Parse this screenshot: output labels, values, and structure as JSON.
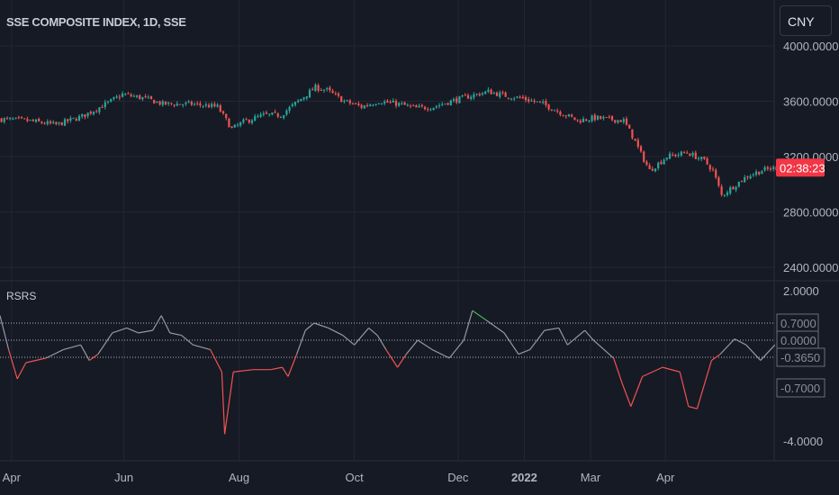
{
  "header": {
    "title": "SSE COMPOSITE INDEX, 1D, SSE",
    "currency": "CNY",
    "countdown": "02:38:23"
  },
  "colors": {
    "up": "#26a69a",
    "down": "#ef5350",
    "neutral": "#9598a1",
    "bg": "#161a25",
    "grid": "#232733",
    "countdown_bg": "#f23645"
  },
  "chart_data": [
    {
      "type": "candlestick",
      "title": "SSE COMPOSITE INDEX, 1D, SSE",
      "y_ticks": [
        "4000.0000",
        "3600.0000",
        "3200.0000",
        "2800.0000",
        "2400.0000"
      ],
      "y_tick_values": [
        4000,
        3600,
        3200,
        2800,
        2400
      ],
      "x_ticks": [
        "Apr",
        "Jun",
        "Aug",
        "Oct",
        "Dec",
        "2022",
        "Mar",
        "Apr"
      ],
      "x_tick_sessions": [
        4,
        43,
        83,
        123,
        159,
        182,
        205,
        231
      ],
      "close_keypoints": [
        [
          0,
          3470
        ],
        [
          9,
          3460
        ],
        [
          19,
          3430
        ],
        [
          28,
          3490
        ],
        [
          38,
          3600
        ],
        [
          42,
          3650
        ],
        [
          50,
          3620
        ],
        [
          56,
          3580
        ],
        [
          66,
          3580
        ],
        [
          75,
          3560
        ],
        [
          80,
          3400
        ],
        [
          84,
          3450
        ],
        [
          91,
          3500
        ],
        [
          97,
          3500
        ],
        [
          103,
          3600
        ],
        [
          109,
          3700
        ],
        [
          113,
          3680
        ],
        [
          119,
          3600
        ],
        [
          125,
          3560
        ],
        [
          131,
          3600
        ],
        [
          138,
          3580
        ],
        [
          144,
          3550
        ],
        [
          150,
          3560
        ],
        [
          156,
          3600
        ],
        [
          163,
          3640
        ],
        [
          169,
          3670
        ],
        [
          175,
          3640
        ],
        [
          181,
          3620
        ],
        [
          188,
          3580
        ],
        [
          194,
          3520
        ],
        [
          200,
          3460
        ],
        [
          206,
          3480
        ],
        [
          216,
          3460
        ],
        [
          219,
          3350
        ],
        [
          222,
          3220
        ],
        [
          225,
          3100
        ],
        [
          231,
          3200
        ],
        [
          238,
          3230
        ],
        [
          244,
          3170
        ],
        [
          247,
          3100
        ],
        [
          250,
          2920
        ],
        [
          255,
          3000
        ],
        [
          259,
          3060
        ],
        [
          264,
          3100
        ],
        [
          269,
          3120
        ]
      ]
    },
    {
      "type": "line",
      "title": "RSRS",
      "y_ticks": [
        "2.0000",
        "-4.0000"
      ],
      "levels": [
        "0.7000",
        "0.0000",
        "-0.3650",
        "-0.7000"
      ],
      "level_values": [
        0.7,
        0,
        -0.365
      ],
      "points": [
        [
          0,
          1.0
        ],
        [
          3,
          -0.2
        ],
        [
          6,
          -1.3
        ],
        [
          9,
          -0.6
        ],
        [
          16,
          -0.4
        ],
        [
          22,
          -0.2
        ],
        [
          28,
          -0.1
        ],
        [
          31,
          -0.5
        ],
        [
          34,
          -0.3
        ],
        [
          39,
          0.3
        ],
        [
          44,
          0.5
        ],
        [
          48,
          0.3
        ],
        [
          53,
          0.4
        ],
        [
          56,
          1.0
        ],
        [
          59,
          0.3
        ],
        [
          63,
          0.2
        ],
        [
          67,
          -0.1
        ],
        [
          73,
          -0.2
        ],
        [
          77,
          -1.0
        ],
        [
          78,
          -3.7
        ],
        [
          81,
          -1.0
        ],
        [
          88,
          -0.9
        ],
        [
          94,
          -0.9
        ],
        [
          98,
          -0.8
        ],
        [
          100,
          -1.2
        ],
        [
          103,
          -0.3
        ],
        [
          106,
          0.4
        ],
        [
          109,
          0.7
        ],
        [
          114,
          0.5
        ],
        [
          119,
          0.2
        ],
        [
          123,
          -0.1
        ],
        [
          128,
          0.5
        ],
        [
          131,
          0.2
        ],
        [
          134,
          -0.2
        ],
        [
          138,
          -0.8
        ],
        [
          141,
          -0.3
        ],
        [
          145,
          0.0
        ],
        [
          150,
          -0.2
        ],
        [
          156,
          -0.4
        ],
        [
          161,
          0.0
        ],
        [
          164,
          1.2
        ],
        [
          169,
          0.8
        ],
        [
          175,
          0.3
        ],
        [
          180,
          -0.3
        ],
        [
          184,
          -0.2
        ],
        [
          189,
          0.4
        ],
        [
          194,
          0.5
        ],
        [
          197,
          -0.1
        ],
        [
          203,
          0.4
        ],
        [
          206,
          0.0
        ],
        [
          213,
          -0.4
        ],
        [
          216,
          -1.5
        ],
        [
          219,
          -2.5
        ],
        [
          223,
          -1.2
        ],
        [
          230,
          -0.8
        ],
        [
          236,
          -1.0
        ],
        [
          239,
          -2.5
        ],
        [
          242,
          -2.6
        ],
        [
          247,
          -0.5
        ],
        [
          250,
          -0.3
        ],
        [
          255,
          0.05
        ],
        [
          259,
          -0.1
        ],
        [
          264,
          -0.5
        ],
        [
          269,
          -0.1
        ]
      ]
    }
  ]
}
